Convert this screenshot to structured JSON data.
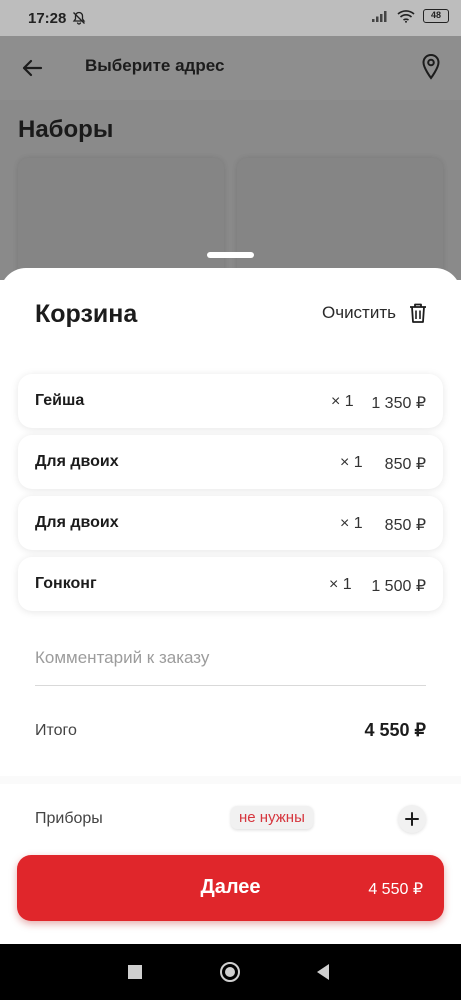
{
  "status_bar": {
    "time": "17:28",
    "battery": "48"
  },
  "app_bar": {
    "title": "Выберите адрес"
  },
  "background": {
    "heading": "Наборы"
  },
  "cart": {
    "title": "Корзина",
    "clear_label": "Очистить",
    "items": [
      {
        "name": "Гейша",
        "qty": "× 1",
        "price": "1 350 ₽"
      },
      {
        "name": "Для двоих",
        "qty": "× 1",
        "price": "850 ₽"
      },
      {
        "name": "Для двоих",
        "qty": "× 1",
        "price": "850 ₽"
      },
      {
        "name": "Гонконг",
        "qty": "× 1",
        "price": "1 500 ₽"
      }
    ],
    "comment_placeholder": "Комментарий к заказу",
    "total_label": "Итого",
    "total_value": "4 550 ₽",
    "cutlery_label": "Приборы",
    "cutlery_value": "не нужны",
    "next_label": "Далее",
    "next_sum": "4 550 ₽"
  },
  "colors": {
    "accent": "#e0262b",
    "badge_text": "#d6353d"
  },
  "icons": [
    "bell-off-icon",
    "signal-icon",
    "wifi-icon",
    "battery-icon",
    "back-arrow-icon",
    "location-pin-icon",
    "trash-icon",
    "plus-icon"
  ]
}
